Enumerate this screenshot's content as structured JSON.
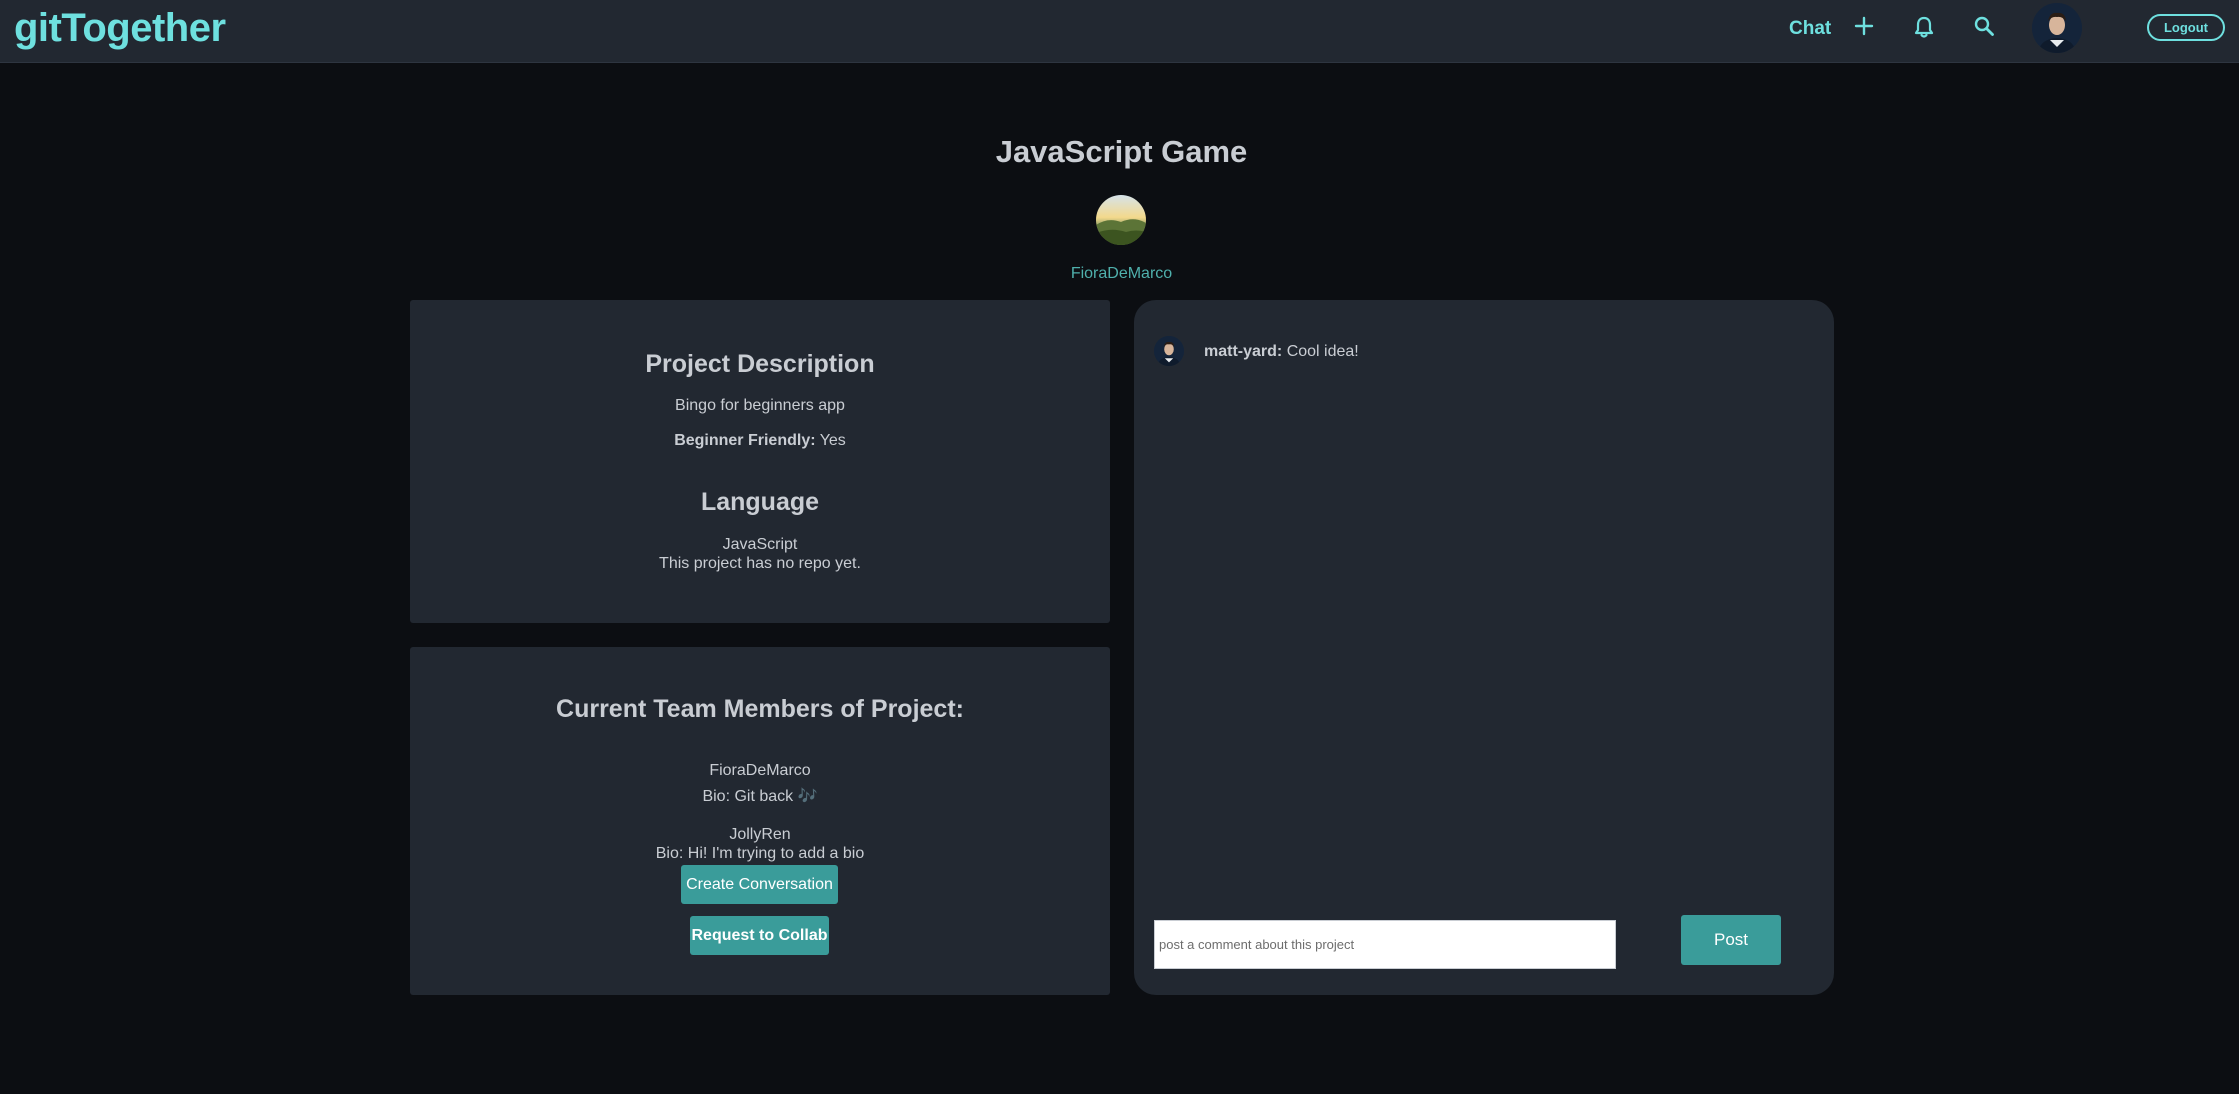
{
  "header": {
    "brand": "gitTogether",
    "nav": {
      "chat_label": "Chat",
      "icons": [
        "plus-icon",
        "bell-icon",
        "search-icon",
        "user-avatar"
      ]
    },
    "logout_label": "Logout",
    "accent_color": "#6ee0df"
  },
  "project": {
    "title": "JavaScript Game",
    "owner": "FioraDeMarco"
  },
  "description_card": {
    "heading": "Project Description",
    "text": "Bingo for beginners app",
    "beginner_friendly_label": "Beginner Friendly:",
    "beginner_friendly_value": "Yes",
    "language_heading": "Language",
    "language_value": "JavaScript",
    "repo_text": "This project has no repo yet."
  },
  "team_card": {
    "heading": "Current Team Members of Project:",
    "members": [
      {
        "name": "FioraDeMarco",
        "bio": "Bio: Git back 🎶"
      },
      {
        "name": "JollyRen",
        "bio": "Bio: Hi! I'm trying to add a bio"
      }
    ],
    "create_conversation_label": "Create Conversation",
    "request_collab_label": "Request to Collab"
  },
  "comments": {
    "items": [
      {
        "user": "matt-yard:",
        "text": "Cool idea!"
      }
    ],
    "input_placeholder": "post a comment about this project",
    "input_value": "",
    "post_label": "Post"
  },
  "colors": {
    "background": "#0c0e12",
    "panel": "#222831",
    "button": "#3a9c9a",
    "link": "#4fb0ac"
  }
}
